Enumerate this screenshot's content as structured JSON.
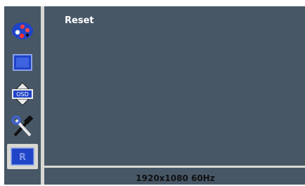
{
  "menu": {
    "title": "Reset",
    "icons": [
      "color-palette-icon",
      "picture-icon",
      "osd-settings-icon",
      "tools-icon",
      "reset-icon"
    ],
    "selected_icon": "reset-icon"
  },
  "status": {
    "resolution": "1920x1080 60Hz"
  },
  "colors": {
    "panel": "#475766",
    "divider": "#d8d8d2",
    "icon_blue": "#1f44c8",
    "text": "#ffffff"
  }
}
